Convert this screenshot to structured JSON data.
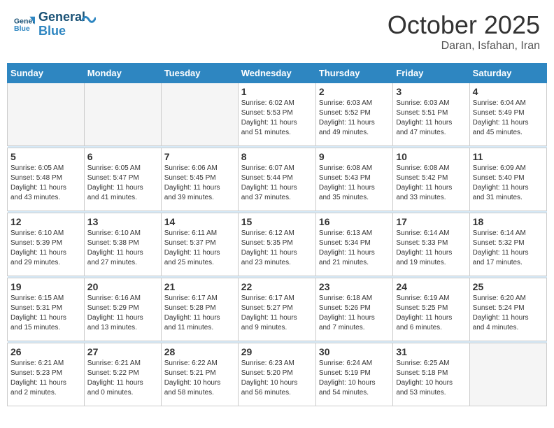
{
  "header": {
    "logo_line1": "General",
    "logo_line2": "Blue",
    "month": "October 2025",
    "location": "Daran, Isfahan, Iran"
  },
  "weekdays": [
    "Sunday",
    "Monday",
    "Tuesday",
    "Wednesday",
    "Thursday",
    "Friday",
    "Saturday"
  ],
  "weeks": [
    [
      {
        "day": "",
        "info": ""
      },
      {
        "day": "",
        "info": ""
      },
      {
        "day": "",
        "info": ""
      },
      {
        "day": "1",
        "info": "Sunrise: 6:02 AM\nSunset: 5:53 PM\nDaylight: 11 hours\nand 51 minutes."
      },
      {
        "day": "2",
        "info": "Sunrise: 6:03 AM\nSunset: 5:52 PM\nDaylight: 11 hours\nand 49 minutes."
      },
      {
        "day": "3",
        "info": "Sunrise: 6:03 AM\nSunset: 5:51 PM\nDaylight: 11 hours\nand 47 minutes."
      },
      {
        "day": "4",
        "info": "Sunrise: 6:04 AM\nSunset: 5:49 PM\nDaylight: 11 hours\nand 45 minutes."
      }
    ],
    [
      {
        "day": "5",
        "info": "Sunrise: 6:05 AM\nSunset: 5:48 PM\nDaylight: 11 hours\nand 43 minutes."
      },
      {
        "day": "6",
        "info": "Sunrise: 6:05 AM\nSunset: 5:47 PM\nDaylight: 11 hours\nand 41 minutes."
      },
      {
        "day": "7",
        "info": "Sunrise: 6:06 AM\nSunset: 5:45 PM\nDaylight: 11 hours\nand 39 minutes."
      },
      {
        "day": "8",
        "info": "Sunrise: 6:07 AM\nSunset: 5:44 PM\nDaylight: 11 hours\nand 37 minutes."
      },
      {
        "day": "9",
        "info": "Sunrise: 6:08 AM\nSunset: 5:43 PM\nDaylight: 11 hours\nand 35 minutes."
      },
      {
        "day": "10",
        "info": "Sunrise: 6:08 AM\nSunset: 5:42 PM\nDaylight: 11 hours\nand 33 minutes."
      },
      {
        "day": "11",
        "info": "Sunrise: 6:09 AM\nSunset: 5:40 PM\nDaylight: 11 hours\nand 31 minutes."
      }
    ],
    [
      {
        "day": "12",
        "info": "Sunrise: 6:10 AM\nSunset: 5:39 PM\nDaylight: 11 hours\nand 29 minutes."
      },
      {
        "day": "13",
        "info": "Sunrise: 6:10 AM\nSunset: 5:38 PM\nDaylight: 11 hours\nand 27 minutes."
      },
      {
        "day": "14",
        "info": "Sunrise: 6:11 AM\nSunset: 5:37 PM\nDaylight: 11 hours\nand 25 minutes."
      },
      {
        "day": "15",
        "info": "Sunrise: 6:12 AM\nSunset: 5:35 PM\nDaylight: 11 hours\nand 23 minutes."
      },
      {
        "day": "16",
        "info": "Sunrise: 6:13 AM\nSunset: 5:34 PM\nDaylight: 11 hours\nand 21 minutes."
      },
      {
        "day": "17",
        "info": "Sunrise: 6:14 AM\nSunset: 5:33 PM\nDaylight: 11 hours\nand 19 minutes."
      },
      {
        "day": "18",
        "info": "Sunrise: 6:14 AM\nSunset: 5:32 PM\nDaylight: 11 hours\nand 17 minutes."
      }
    ],
    [
      {
        "day": "19",
        "info": "Sunrise: 6:15 AM\nSunset: 5:31 PM\nDaylight: 11 hours\nand 15 minutes."
      },
      {
        "day": "20",
        "info": "Sunrise: 6:16 AM\nSunset: 5:29 PM\nDaylight: 11 hours\nand 13 minutes."
      },
      {
        "day": "21",
        "info": "Sunrise: 6:17 AM\nSunset: 5:28 PM\nDaylight: 11 hours\nand 11 minutes."
      },
      {
        "day": "22",
        "info": "Sunrise: 6:17 AM\nSunset: 5:27 PM\nDaylight: 11 hours\nand 9 minutes."
      },
      {
        "day": "23",
        "info": "Sunrise: 6:18 AM\nSunset: 5:26 PM\nDaylight: 11 hours\nand 7 minutes."
      },
      {
        "day": "24",
        "info": "Sunrise: 6:19 AM\nSunset: 5:25 PM\nDaylight: 11 hours\nand 6 minutes."
      },
      {
        "day": "25",
        "info": "Sunrise: 6:20 AM\nSunset: 5:24 PM\nDaylight: 11 hours\nand 4 minutes."
      }
    ],
    [
      {
        "day": "26",
        "info": "Sunrise: 6:21 AM\nSunset: 5:23 PM\nDaylight: 11 hours\nand 2 minutes."
      },
      {
        "day": "27",
        "info": "Sunrise: 6:21 AM\nSunset: 5:22 PM\nDaylight: 11 hours\nand 0 minutes."
      },
      {
        "day": "28",
        "info": "Sunrise: 6:22 AM\nSunset: 5:21 PM\nDaylight: 10 hours\nand 58 minutes."
      },
      {
        "day": "29",
        "info": "Sunrise: 6:23 AM\nSunset: 5:20 PM\nDaylight: 10 hours\nand 56 minutes."
      },
      {
        "day": "30",
        "info": "Sunrise: 6:24 AM\nSunset: 5:19 PM\nDaylight: 10 hours\nand 54 minutes."
      },
      {
        "day": "31",
        "info": "Sunrise: 6:25 AM\nSunset: 5:18 PM\nDaylight: 10 hours\nand 53 minutes."
      },
      {
        "day": "",
        "info": ""
      }
    ]
  ]
}
